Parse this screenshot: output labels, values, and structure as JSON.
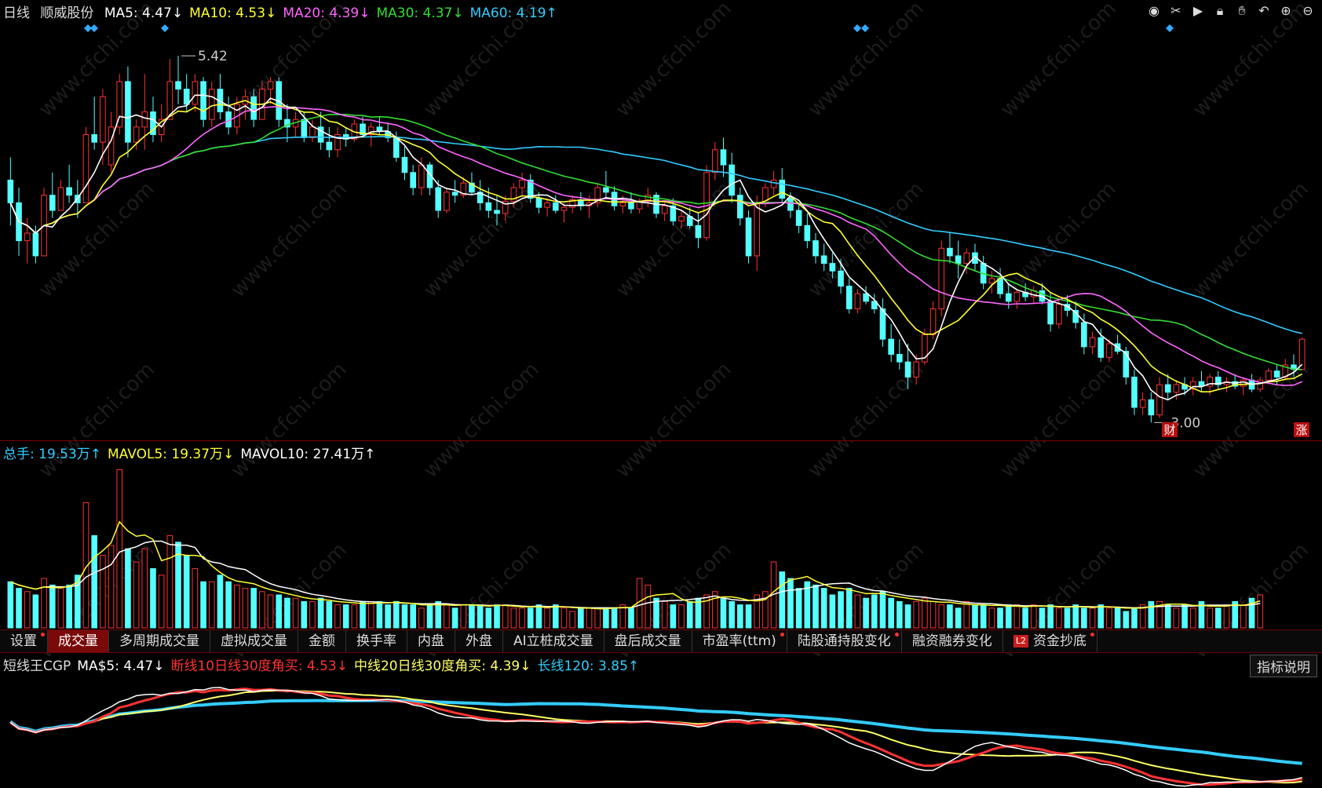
{
  "header": {
    "period": "日线",
    "stock_name": "顺威股份",
    "ma_items": [
      {
        "label": "MA5: 4.47↓",
        "color": "#ffffff"
      },
      {
        "label": "MA10: 4.53↓",
        "color": "#ffff33"
      },
      {
        "label": "MA20: 4.39↓",
        "color": "#ff66ff"
      },
      {
        "label": "MA30: 4.37↓",
        "color": "#33dd33"
      },
      {
        "label": "MA60: 4.19↑",
        "color": "#33ccff"
      }
    ]
  },
  "toolbar_icons": [
    "eye-icon",
    "scissors-icon",
    "play-icon",
    "lock-icon",
    "hand-icon",
    "undo-icon",
    "zoom-in-icon",
    "zoom-out-icon"
  ],
  "price_annotations": {
    "high": "5.42",
    "low": "3.00",
    "marker_cai": "财",
    "marker_zhang": "涨"
  },
  "volume_header": [
    {
      "label": "总手: 19.53万↑",
      "color": "#33ccff"
    },
    {
      "label": "MAVOL5: 19.37万↓",
      "color": "#ffff33"
    },
    {
      "label": "MAVOL10: 27.41万↑",
      "color": "#ffffff"
    }
  ],
  "tabs": [
    {
      "label": "设置",
      "dot": true,
      "active": false
    },
    {
      "label": "成交量",
      "dot": false,
      "active": true
    },
    {
      "label": "多周期成交量",
      "dot": false,
      "active": false
    },
    {
      "label": "虚拟成交量",
      "dot": false,
      "active": false
    },
    {
      "label": "金额",
      "dot": false,
      "active": false
    },
    {
      "label": "换手率",
      "dot": false,
      "active": false
    },
    {
      "label": "内盘",
      "dot": false,
      "active": false
    },
    {
      "label": "外盘",
      "dot": false,
      "active": false
    },
    {
      "label": "AI立桩成交量",
      "dot": false,
      "active": false
    },
    {
      "label": "盘后成交量",
      "dot": false,
      "active": false
    },
    {
      "label": "市盈率(ttm)",
      "dot": true,
      "active": false
    },
    {
      "label": "陆股通持股变化",
      "dot": true,
      "active": false
    },
    {
      "label": "融资融券变化",
      "dot": false,
      "active": false
    },
    {
      "label": "资金抄底",
      "dot": true,
      "active": false,
      "badge": "L2"
    }
  ],
  "indicator_header": [
    {
      "label": "短线王CGP",
      "color": "#dddddd"
    },
    {
      "label": "MA$5: 4.47↓",
      "color": "#ffffff"
    },
    {
      "label": "断线10日线30度角买: 4.53↓",
      "color": "#ff3333"
    },
    {
      "label": "中线20日线30度角买: 4.39↓",
      "color": "#ffff66"
    },
    {
      "label": "长线120: 3.85↑",
      "color": "#33ccff"
    }
  ],
  "explain_button": "指标说明",
  "watermark": "www.cfchi.com",
  "colors": {
    "up": "#ff3232",
    "down": "#54ffff",
    "bg": "#000000",
    "sep": "#7a0000"
  },
  "chart_data": {
    "type": "candlestick",
    "price_range_visible": [
      2.9,
      5.6
    ],
    "candles": [
      [
        4.6,
        4.75,
        4.3,
        4.45
      ],
      [
        4.45,
        4.55,
        4.1,
        4.2
      ],
      [
        4.2,
        4.35,
        4.05,
        4.25
      ],
      [
        4.25,
        4.3,
        4.05,
        4.1
      ],
      [
        4.1,
        4.55,
        4.1,
        4.5
      ],
      [
        4.5,
        4.65,
        4.35,
        4.4
      ],
      [
        4.4,
        4.6,
        4.4,
        4.55
      ],
      [
        4.55,
        4.7,
        4.45,
        4.5
      ],
      [
        4.5,
        4.6,
        4.35,
        4.45
      ],
      [
        4.45,
        4.95,
        4.45,
        4.9
      ],
      [
        4.9,
        5.15,
        4.8,
        4.85
      ],
      [
        4.85,
        5.2,
        4.7,
        5.15
      ],
      [
        4.7,
        5.05,
        4.65,
        4.95
      ],
      [
        4.95,
        5.3,
        4.9,
        5.25
      ],
      [
        5.25,
        5.35,
        4.75,
        4.85
      ],
      [
        4.85,
        5.0,
        4.8,
        4.95
      ],
      [
        4.95,
        5.3,
        4.8,
        5.05
      ],
      [
        5.05,
        5.15,
        4.85,
        4.9
      ],
      [
        4.9,
        5.1,
        4.85,
        5.0
      ],
      [
        5.0,
        5.4,
        5.0,
        5.25
      ],
      [
        5.25,
        5.42,
        5.1,
        5.2
      ],
      [
        5.2,
        5.3,
        5.05,
        5.1
      ],
      [
        5.1,
        5.3,
        5.05,
        5.25
      ],
      [
        5.25,
        5.28,
        4.95,
        5.0
      ],
      [
        5.0,
        5.25,
        4.95,
        5.2
      ],
      [
        5.2,
        5.3,
        5.0,
        5.05
      ],
      [
        5.05,
        5.15,
        4.9,
        4.95
      ],
      [
        4.95,
        5.15,
        4.9,
        5.1
      ],
      [
        5.1,
        5.2,
        5.0,
        5.15
      ],
      [
        5.15,
        5.2,
        4.95,
        5.0
      ],
      [
        5.0,
        5.25,
        5.0,
        5.2
      ],
      [
        5.2,
        5.28,
        5.1,
        5.25
      ],
      [
        5.25,
        5.28,
        4.95,
        5.0
      ],
      [
        5.0,
        5.1,
        4.85,
        4.95
      ],
      [
        4.95,
        5.05,
        4.88,
        5.0
      ],
      [
        5.0,
        5.05,
        4.85,
        4.88
      ],
      [
        4.88,
        5.0,
        4.85,
        4.95
      ],
      [
        4.95,
        5.05,
        4.8,
        4.85
      ],
      [
        4.85,
        4.95,
        4.75,
        4.8
      ],
      [
        4.8,
        4.95,
        4.75,
        4.9
      ],
      [
        4.9,
        4.95,
        4.82,
        4.87
      ],
      [
        4.87,
        5.0,
        4.85,
        4.97
      ],
      [
        4.97,
        5.02,
        4.88,
        4.9
      ],
      [
        4.9,
        4.98,
        4.82,
        4.95
      ],
      [
        4.95,
        5.02,
        4.9,
        4.92
      ],
      [
        4.92,
        4.98,
        4.85,
        4.88
      ],
      [
        4.88,
        4.92,
        4.72,
        4.75
      ],
      [
        4.75,
        4.82,
        4.6,
        4.65
      ],
      [
        4.65,
        4.7,
        4.5,
        4.55
      ],
      [
        4.55,
        4.75,
        4.5,
        4.7
      ],
      [
        4.7,
        4.72,
        4.5,
        4.55
      ],
      [
        4.55,
        4.6,
        4.35,
        4.4
      ],
      [
        4.4,
        4.55,
        4.38,
        4.52
      ],
      [
        4.52,
        4.6,
        4.45,
        4.5
      ],
      [
        4.5,
        4.62,
        4.48,
        4.58
      ],
      [
        4.58,
        4.65,
        4.5,
        4.52
      ],
      [
        4.52,
        4.6,
        4.4,
        4.45
      ],
      [
        4.45,
        4.55,
        4.35,
        4.4
      ],
      [
        4.4,
        4.5,
        4.3,
        4.38
      ],
      [
        4.38,
        4.5,
        4.33,
        4.46
      ],
      [
        4.46,
        4.58,
        4.42,
        4.55
      ],
      [
        4.55,
        4.65,
        4.5,
        4.6
      ],
      [
        4.6,
        4.64,
        4.45,
        4.48
      ],
      [
        4.48,
        4.52,
        4.38,
        4.42
      ],
      [
        4.42,
        4.48,
        4.36,
        4.45
      ],
      [
        4.45,
        4.5,
        4.38,
        4.4
      ],
      [
        4.4,
        4.45,
        4.32,
        4.42
      ],
      [
        4.42,
        4.5,
        4.38,
        4.47
      ],
      [
        4.47,
        4.52,
        4.4,
        4.43
      ],
      [
        4.43,
        4.5,
        4.35,
        4.45
      ],
      [
        4.45,
        4.58,
        4.42,
        4.55
      ],
      [
        4.55,
        4.66,
        4.48,
        4.52
      ],
      [
        4.52,
        4.56,
        4.4,
        4.43
      ],
      [
        4.43,
        4.5,
        4.38,
        4.45
      ],
      [
        4.45,
        4.52,
        4.38,
        4.41
      ],
      [
        4.41,
        4.48,
        4.38,
        4.46
      ],
      [
        4.46,
        4.55,
        4.42,
        4.5
      ],
      [
        4.5,
        4.52,
        4.35,
        4.38
      ],
      [
        4.38,
        4.46,
        4.33,
        4.43
      ],
      [
        4.43,
        4.48,
        4.3,
        4.33
      ],
      [
        4.33,
        4.4,
        4.28,
        4.36
      ],
      [
        4.36,
        4.42,
        4.28,
        4.3
      ],
      [
        4.3,
        4.38,
        4.15,
        4.22
      ],
      [
        4.22,
        4.7,
        4.2,
        4.65
      ],
      [
        4.65,
        4.85,
        4.6,
        4.8
      ],
      [
        4.8,
        4.88,
        4.62,
        4.7
      ],
      [
        4.7,
        4.78,
        4.45,
        4.5
      ],
      [
        4.5,
        4.55,
        4.3,
        4.35
      ],
      [
        4.35,
        4.4,
        4.05,
        4.1
      ],
      [
        4.1,
        4.5,
        4.0,
        4.45
      ],
      [
        4.45,
        4.58,
        4.42,
        4.55
      ],
      [
        4.55,
        4.66,
        4.5,
        4.6
      ],
      [
        4.6,
        4.68,
        4.45,
        4.48
      ],
      [
        4.48,
        4.52,
        4.35,
        4.4
      ],
      [
        4.4,
        4.45,
        4.25,
        4.3
      ],
      [
        4.3,
        4.38,
        4.15,
        4.2
      ],
      [
        4.2,
        4.25,
        4.05,
        4.1
      ],
      [
        4.1,
        4.18,
        4.0,
        4.05
      ],
      [
        4.05,
        4.12,
        3.95,
        4.0
      ],
      [
        4.0,
        4.08,
        3.85,
        3.9
      ],
      [
        3.9,
        3.95,
        3.72,
        3.75
      ],
      [
        3.75,
        3.88,
        3.72,
        3.85
      ],
      [
        3.85,
        3.9,
        3.78,
        3.8
      ],
      [
        3.8,
        3.85,
        3.72,
        3.75
      ],
      [
        3.75,
        3.82,
        3.5,
        3.55
      ],
      [
        3.55,
        3.65,
        3.4,
        3.45
      ],
      [
        3.45,
        3.55,
        3.35,
        3.4
      ],
      [
        3.4,
        3.52,
        3.22,
        3.3
      ],
      [
        3.3,
        3.45,
        3.25,
        3.4
      ],
      [
        3.4,
        3.62,
        3.38,
        3.58
      ],
      [
        3.58,
        3.8,
        3.55,
        3.75
      ],
      [
        3.75,
        4.2,
        3.7,
        4.15
      ],
      [
        4.15,
        4.25,
        4.05,
        4.1
      ],
      [
        4.1,
        4.2,
        3.95,
        4.05
      ],
      [
        4.05,
        4.15,
        3.98,
        4.12
      ],
      [
        4.12,
        4.18,
        4.0,
        4.05
      ],
      [
        4.05,
        4.1,
        3.88,
        3.92
      ],
      [
        3.92,
        4.0,
        3.85,
        3.95
      ],
      [
        3.95,
        4.02,
        3.82,
        3.85
      ],
      [
        3.85,
        3.92,
        3.75,
        3.8
      ],
      [
        3.8,
        3.88,
        3.75,
        3.86
      ],
      [
        3.86,
        3.92,
        3.8,
        3.83
      ],
      [
        3.83,
        3.9,
        3.78,
        3.87
      ],
      [
        3.87,
        3.92,
        3.78,
        3.8
      ],
      [
        3.8,
        3.86,
        3.6,
        3.65
      ],
      [
        3.65,
        3.82,
        3.62,
        3.78
      ],
      [
        3.78,
        3.84,
        3.7,
        3.74
      ],
      [
        3.74,
        3.8,
        3.62,
        3.66
      ],
      [
        3.66,
        3.72,
        3.45,
        3.5
      ],
      [
        3.5,
        3.6,
        3.45,
        3.56
      ],
      [
        3.56,
        3.62,
        3.4,
        3.43
      ],
      [
        3.43,
        3.55,
        3.4,
        3.52
      ],
      [
        3.52,
        3.58,
        3.45,
        3.47
      ],
      [
        3.47,
        3.5,
        3.25,
        3.3
      ],
      [
        3.3,
        3.35,
        3.05,
        3.1
      ],
      [
        3.1,
        3.2,
        3.05,
        3.15
      ],
      [
        3.15,
        3.2,
        3.0,
        3.05
      ],
      [
        3.05,
        3.3,
        3.03,
        3.25
      ],
      [
        3.25,
        3.32,
        3.15,
        3.2
      ],
      [
        3.2,
        3.28,
        3.15,
        3.25
      ],
      [
        3.25,
        3.3,
        3.18,
        3.22
      ],
      [
        3.22,
        3.3,
        3.18,
        3.27
      ],
      [
        3.27,
        3.34,
        3.2,
        3.24
      ],
      [
        3.24,
        3.32,
        3.18,
        3.3
      ],
      [
        3.3,
        3.34,
        3.22,
        3.25
      ],
      [
        3.25,
        3.3,
        3.2,
        3.27
      ],
      [
        3.27,
        3.32,
        3.22,
        3.24
      ],
      [
        3.24,
        3.3,
        3.18,
        3.28
      ],
      [
        3.28,
        3.32,
        3.2,
        3.22
      ],
      [
        3.22,
        3.3,
        3.2,
        3.28
      ],
      [
        3.28,
        3.36,
        3.25,
        3.34
      ],
      [
        3.34,
        3.38,
        3.25,
        3.3
      ],
      [
        3.3,
        3.42,
        3.28,
        3.38
      ],
      [
        3.38,
        3.45,
        3.3,
        3.35
      ],
      [
        3.35,
        3.56,
        3.35,
        3.55
      ]
    ],
    "volume": [
      14,
      12,
      11,
      10,
      15,
      13,
      12,
      13,
      16,
      38,
      28,
      22,
      25,
      48,
      24,
      20,
      24,
      18,
      16,
      28,
      26,
      22,
      18,
      14,
      14,
      16,
      14,
      13,
      12,
      12,
      11,
      10,
      10,
      9,
      9,
      8,
      8,
      9,
      8,
      7,
      7,
      7,
      8,
      8,
      8,
      7,
      8,
      7,
      7,
      6,
      7,
      8,
      7,
      6,
      7,
      7,
      7,
      6,
      7,
      7,
      6,
      6,
      6,
      7,
      6,
      7,
      6,
      5,
      6,
      6,
      6,
      6,
      6,
      7,
      6,
      15,
      13,
      9,
      8,
      7,
      7,
      8,
      9,
      10,
      11,
      9,
      8,
      7,
      7,
      10,
      11,
      20,
      17,
      15,
      12,
      14,
      13,
      12,
      10,
      11,
      12,
      10,
      9,
      10,
      11,
      9,
      8,
      7,
      8,
      9,
      8,
      7,
      7,
      6,
      8,
      7,
      7,
      6,
      6,
      7,
      7,
      6,
      7,
      6,
      7,
      6,
      6,
      7,
      6,
      6,
      7,
      6,
      6,
      5,
      6,
      7,
      8,
      8,
      7,
      6,
      7,
      6,
      8,
      6,
      6,
      7,
      8,
      7,
      9,
      10
    ]
  }
}
